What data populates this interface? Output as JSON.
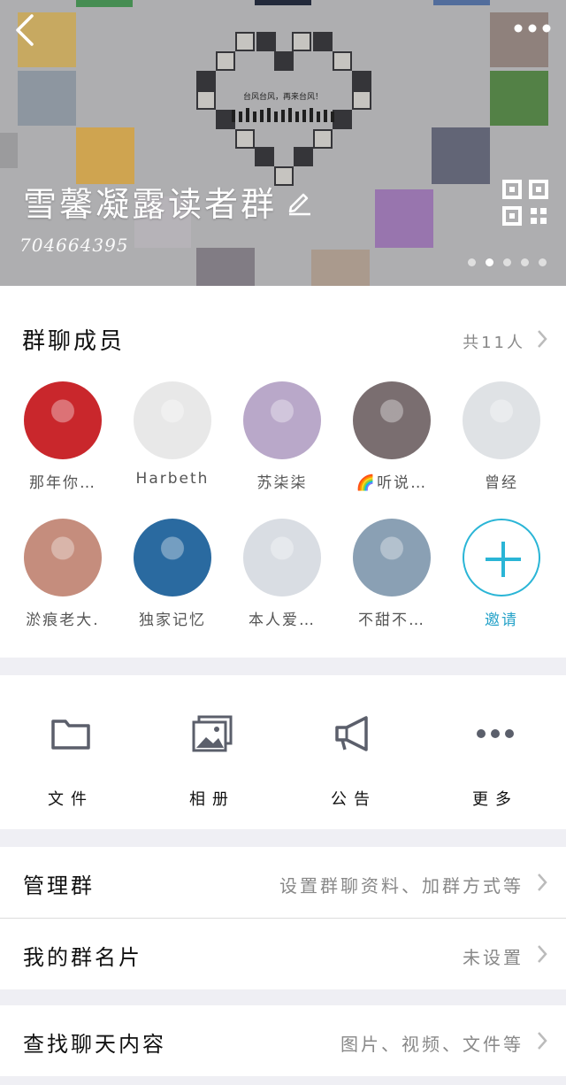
{
  "header": {
    "group_name": "雪馨凝露读者群",
    "group_id": "704664395",
    "banner_caption": "台风台风，再来台风！",
    "carousel": {
      "count": 5,
      "active_index": 1
    },
    "icons": {
      "back": "back-chevron-icon",
      "more": "more-dots-icon",
      "edit": "edit-pencil-icon",
      "qr": "qr-code-icon"
    }
  },
  "members": {
    "title": "群聊成员",
    "count_label": "共11人",
    "list": [
      {
        "name": "那年你…",
        "color": "#c9272c"
      },
      {
        "name": "Harbeth",
        "color": "#e8e8e8"
      },
      {
        "name": "苏柒柒",
        "color": "#b9a8c9"
      },
      {
        "name": "🌈听说…",
        "color": "#7a6e70"
      },
      {
        "name": "曾经",
        "color": "#dfe2e5"
      },
      {
        "name": "淤痕老大.",
        "color": "#c58d7d"
      },
      {
        "name": "独家记忆",
        "color": "#2a6aa0"
      },
      {
        "name": "本人爱…",
        "color": "#d9dde3"
      },
      {
        "name": "不甜不…",
        "color": "#8aa0b4"
      }
    ],
    "invite_label": "邀请"
  },
  "tools": [
    {
      "label": "文件",
      "icon": "folder-icon"
    },
    {
      "label": "相册",
      "icon": "photo-album-icon"
    },
    {
      "label": "公告",
      "icon": "megaphone-icon"
    },
    {
      "label": "更多",
      "icon": "more-horizontal-icon"
    }
  ],
  "rows": {
    "manage": {
      "title": "管理群",
      "value": "设置群聊资料、加群方式等"
    },
    "card": {
      "title": "我的群名片",
      "value": "未设置"
    },
    "search": {
      "title": "查找聊天内容",
      "value": "图片、视频、文件等"
    }
  },
  "colors": {
    "accent": "#2ab5d6",
    "icon_gray": "#5b5f6b"
  }
}
